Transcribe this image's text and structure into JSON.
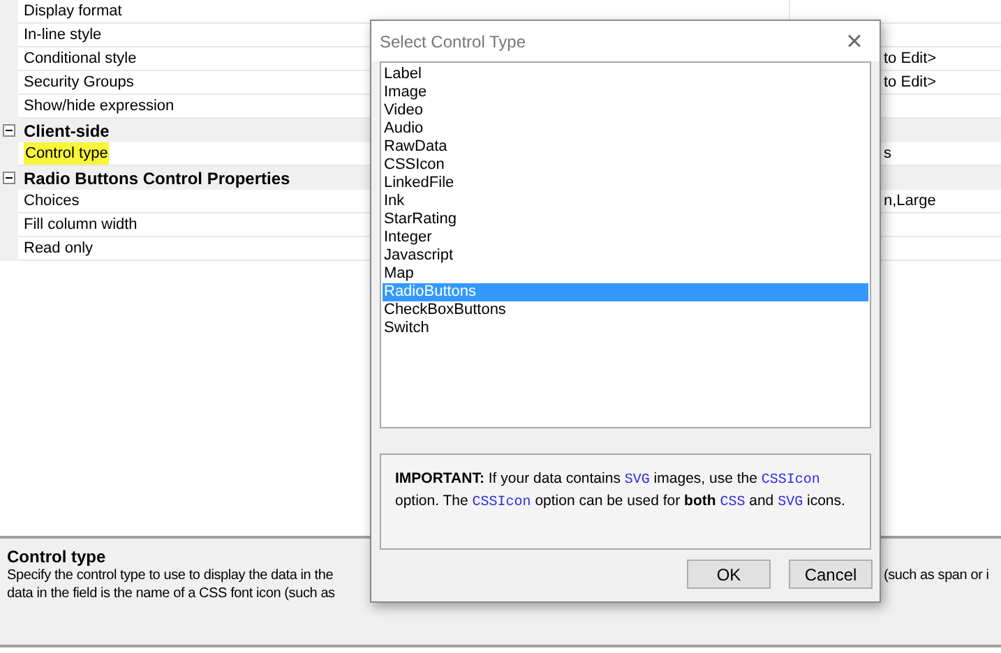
{
  "grid": {
    "rows": [
      {
        "kind": "property",
        "name": "Display format",
        "highlighted": false
      },
      {
        "kind": "property",
        "name": "In-line style",
        "highlighted": false
      },
      {
        "kind": "property",
        "name": "Conditional style",
        "value": "to Edit>",
        "highlighted": false
      },
      {
        "kind": "property",
        "name": "Security Groups",
        "value": "to Edit>",
        "highlighted": false
      },
      {
        "kind": "property",
        "name": "Show/hide expression",
        "highlighted": false
      },
      {
        "kind": "category",
        "name": "Client-side",
        "expanded": true
      },
      {
        "kind": "property",
        "name": "Control type",
        "value": "s",
        "highlighted": true
      },
      {
        "kind": "category",
        "name": "Radio Buttons Control Properties",
        "expanded": true
      },
      {
        "kind": "property",
        "name": "Choices",
        "value": "n,Large",
        "highlighted": false
      },
      {
        "kind": "property",
        "name": "Fill column width",
        "highlighted": false
      },
      {
        "kind": "property",
        "name": "Read only",
        "highlighted": false
      }
    ]
  },
  "description": {
    "title": "Control type",
    "lines": [
      {
        "left": "Specify the control type to use to display the data in the",
        "right": "(such as span or i"
      },
      {
        "left": "data in the field is the name of a CSS font icon (such as"
      }
    ]
  },
  "dialog": {
    "title": "Select Control Type",
    "close": "×",
    "items": [
      {
        "label": "Label",
        "selected": false
      },
      {
        "label": "Image",
        "selected": false
      },
      {
        "label": "Video",
        "selected": false
      },
      {
        "label": "Audio",
        "selected": false
      },
      {
        "label": "RawData",
        "selected": false
      },
      {
        "label": "CSSIcon",
        "selected": false
      },
      {
        "label": "LinkedFile",
        "selected": false
      },
      {
        "label": "Ink",
        "selected": false
      },
      {
        "label": "StarRating",
        "selected": false
      },
      {
        "label": "Integer",
        "selected": false
      },
      {
        "label": "Javascript",
        "selected": false
      },
      {
        "label": "Map",
        "selected": false
      },
      {
        "label": "RadioButtons",
        "selected": true
      },
      {
        "label": "CheckBoxButtons",
        "selected": false
      },
      {
        "label": "Switch",
        "selected": false
      }
    ],
    "info": [
      {
        "kind": "bold",
        "text": "IMPORTANT:"
      },
      {
        "kind": "text",
        "text": " If your data contains "
      },
      {
        "kind": "code",
        "text": "SVG"
      },
      {
        "kind": "text",
        "text": " images, use the "
      },
      {
        "kind": "code",
        "text": "CSSIcon"
      },
      {
        "kind": "text",
        "text": " option. The "
      },
      {
        "kind": "code",
        "text": "CSSIcon"
      },
      {
        "kind": "text",
        "text": " option can be used for "
      },
      {
        "kind": "bold",
        "text": "both "
      },
      {
        "kind": "code",
        "text": "CSS"
      },
      {
        "kind": "text",
        "text": " and "
      },
      {
        "kind": "code",
        "text": "SVG"
      },
      {
        "kind": "text",
        "text": " icons."
      }
    ],
    "buttons": [
      {
        "label": "OK"
      },
      {
        "label": "Cancel"
      }
    ]
  }
}
